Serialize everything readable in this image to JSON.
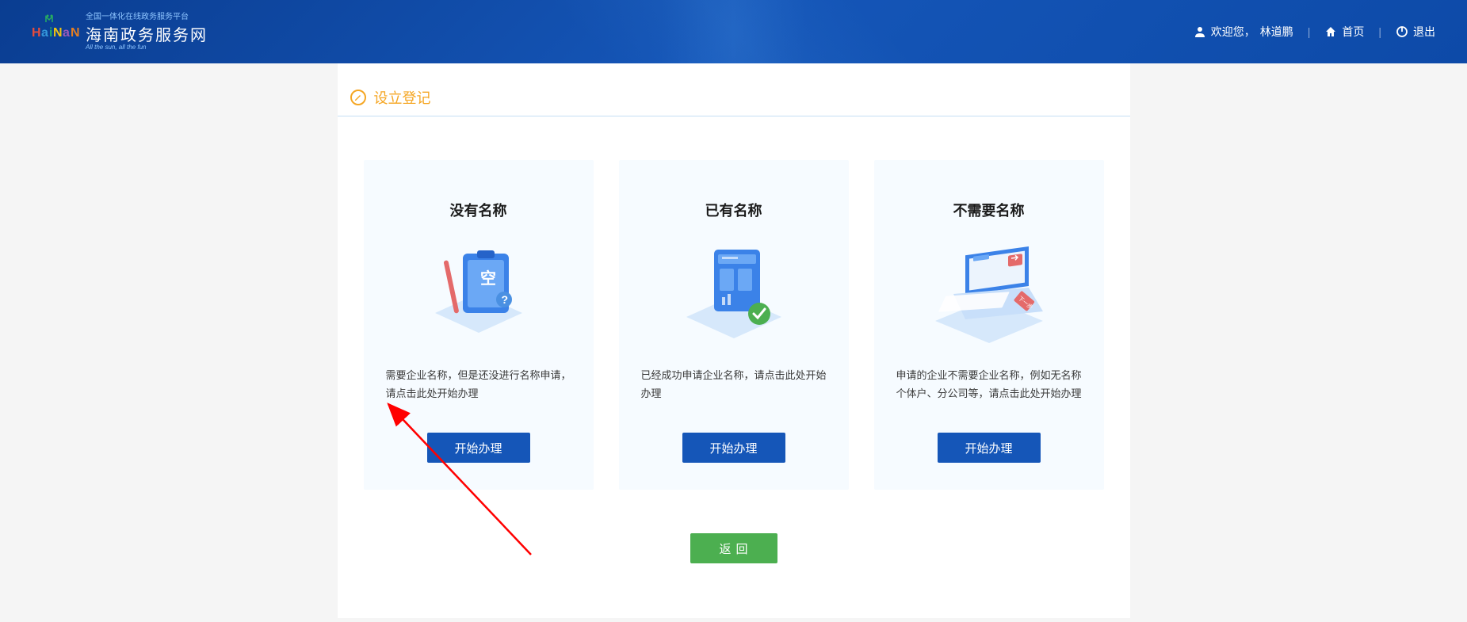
{
  "header": {
    "logo_subtitle": "全国一体化在线政务服务平台",
    "logo_title": "海南政务服务网",
    "logo_tagline": "All the sun, all the fun",
    "welcome_prefix": "欢迎您，",
    "username": "林道鹏",
    "home_label": "首页",
    "logout_label": "退出"
  },
  "section": {
    "title": "设立登记"
  },
  "cards": [
    {
      "title": "没有名称",
      "description": "需要企业名称，但是还没进行名称申请，请点击此处开始办理",
      "button": "开始办理"
    },
    {
      "title": "已有名称",
      "description": "已经成功申请企业名称，请点击此处开始办理",
      "button": "开始办理"
    },
    {
      "title": "不需要名称",
      "description": "申请的企业不需要企业名称，例如无名称个体户、分公司等，请点击此处开始办理",
      "button": "开始办理"
    }
  ],
  "back_button": "返回",
  "illustration_labels": {
    "card0_char": "空",
    "card2_next": "下一步"
  }
}
